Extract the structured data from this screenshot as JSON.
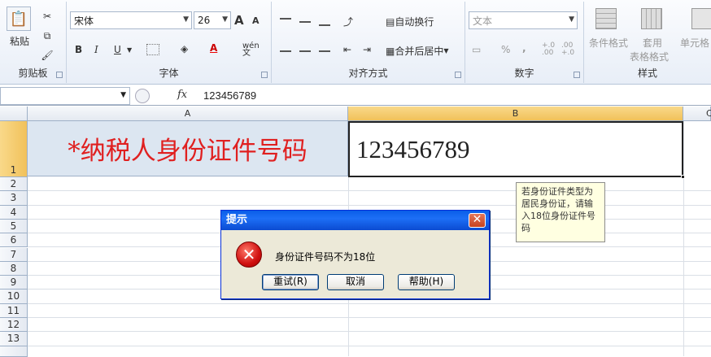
{
  "ribbon": {
    "clipboard": {
      "label": "剪贴板",
      "paste": "粘贴"
    },
    "font": {
      "label": "字体",
      "name": "宋体",
      "size": "26",
      "grow": "A",
      "shrink": "A",
      "bold": "B",
      "italic": "I",
      "underline": "U",
      "font_color_glyph": "A",
      "wen": "wén\n文"
    },
    "align": {
      "label": "对齐方式",
      "wrap": "自动换行",
      "merge": "合并后居中"
    },
    "number": {
      "label": "数字",
      "format": "文本",
      "percent": "%",
      "comma": ",",
      "inc_dec": "+.0\n.00",
      "dec_dec": ".00\n+.0"
    },
    "styles": {
      "label": "样式",
      "conditional": "条件格式",
      "table_fmt_1": "套用",
      "table_fmt_2": "表格格式",
      "cell_style": "单元格"
    }
  },
  "formula_bar": {
    "name_box": "",
    "fx": "fx",
    "content": "123456789"
  },
  "grid": {
    "columns": [
      "A",
      "B",
      "C"
    ],
    "rows": [
      "1",
      "2",
      "3",
      "4",
      "5",
      "6",
      "7",
      "8",
      "9",
      "10",
      "11",
      "12",
      "13"
    ],
    "a1": "*纳税人身份证件号码",
    "b1": "123456789"
  },
  "tooltip": "若身份证件类型为居民身份证，请输入18位身份证件号码",
  "dialog": {
    "title": "提示",
    "close": "✕",
    "icon": "✕",
    "message": "身份证件号码不为18位",
    "buttons": {
      "retry": "重试(R)",
      "cancel": "取消",
      "help": "帮助(H)"
    }
  }
}
